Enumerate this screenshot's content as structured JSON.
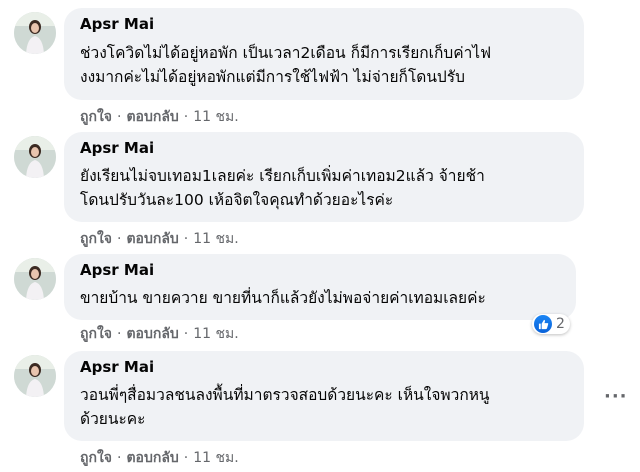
{
  "comments": [
    {
      "author": "Apsr Mai",
      "lines": [
        "ช่วงโควิดไม่ได้อยู่หอพัก เป็นเวลา2เดือน ก็มีการเรียกเก็บค่าไฟ",
        "งงมากค่ะไม่ได้อยู่หอพักแต่มีการใช้ไฟฟ้า ไม่จ่ายก็โดนปรับ"
      ],
      "like": "ถูกใจ",
      "reply": "ตอบกลับ",
      "time": "11 ชม."
    },
    {
      "author": "Apsr Mai",
      "lines": [
        "ยังเรียนไม่จบเทอม1เลยค่ะ เรียกเก็บเพิ่มค่าเทอม2แล้ว จ้ายช้า",
        "โดนปรับวันละ100 เห้อจิตใจคุณทำด้วยอะไรค่ะ"
      ],
      "like": "ถูกใจ",
      "reply": "ตอบกลับ",
      "time": "11 ชม."
    },
    {
      "author": "Apsr Mai",
      "lines": [
        "ขายบ้าน ขายควาย ขายที่นาก็แล้วยังไม่พอจ่ายค่าเทอมเลยค่ะ"
      ],
      "like": "ถูกใจ",
      "reply": "ตอบกลับ",
      "time": "11 ชม.",
      "reaction_count": "2"
    },
    {
      "author": "Apsr Mai",
      "lines": [
        "วอนพี่ๆสื่อมวลชนลงพื้นที่มาตรวจสอบด้วยนะคะ เห็นใจพวกหนู",
        "ด้วยนะคะ"
      ],
      "like": "ถูกใจ",
      "reply": "ตอบกลับ",
      "time": "11 ชม."
    }
  ],
  "separator": "·",
  "more_label": "···",
  "colors": {
    "bubble": "#f0f2f5",
    "meta": "#65676b",
    "like_blue": "#1877f2"
  },
  "icons": {
    "avatar": "profile-photo",
    "reaction": "like-thumbs-up-icon",
    "more": "more-options-icon"
  }
}
